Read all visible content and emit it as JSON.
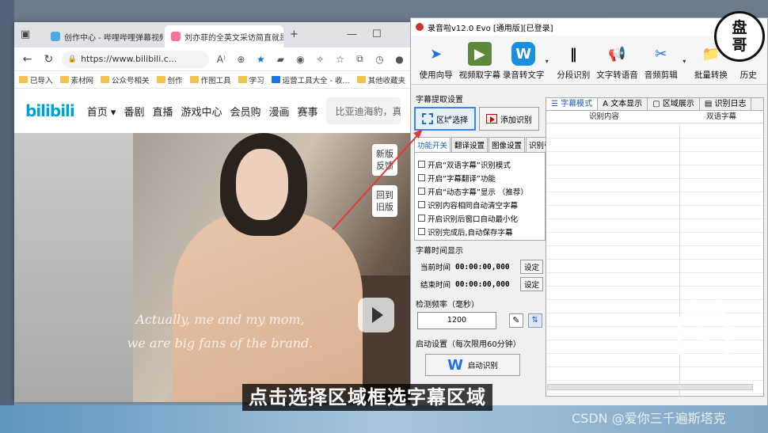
{
  "browser": {
    "tabs": [
      {
        "title": "创作中心 - 哔哩哔哩弹幕视频网",
        "close": "✕"
      },
      {
        "title": "刘亦菲的全英文采访简直就是一",
        "close": "✕"
      }
    ],
    "new_tab": "+",
    "minimize": "—",
    "maximize": "☐",
    "url": "https://www.bilibili.c...",
    "toolbar_icons": {
      "read_aloud": "A⁾",
      "zoom": "⊕",
      "favorite": "★"
    },
    "bookmarks": [
      "已导入",
      "素材网",
      "公众号相关",
      "创作",
      "作图工具",
      "学习",
      "运营工具大全 - 收...",
      "其他收藏夹"
    ]
  },
  "bili": {
    "logo": "bilibili",
    "nav": [
      "首页",
      "番剧",
      "直播",
      "游戏中心",
      "会员购",
      "漫画",
      "赛事"
    ],
    "search_placeholder": "比亚迪海豹，真有网上吹",
    "float_new": "新版 反馈",
    "float_old": "回到 旧版",
    "subtitle_en_1": "Actually, me and my mom,",
    "subtitle_en_2": "we are big fans of the brand."
  },
  "app": {
    "title": "录音啦v12.0 Evo [通用版][已登录]",
    "tools": [
      {
        "label": "使用向导",
        "icon": "➤"
      },
      {
        "label": "视频取字幕",
        "icon": "▶"
      },
      {
        "label": "录音转文字",
        "icon": "W"
      },
      {
        "label": "分段识别",
        "icon": "‖"
      },
      {
        "label": "文字转语音",
        "icon": "📢"
      },
      {
        "label": "音频剪辑",
        "icon": "✂"
      },
      {
        "label": "批量转换",
        "icon": "📁"
      },
      {
        "label": "历史",
        "icon": "⟲"
      }
    ],
    "group_subtitle": "字幕提取设置",
    "btn_region": "区域选择",
    "btn_add": "添加识别",
    "subtabs": [
      "功能开关",
      "翻译设置",
      "图像设置",
      "识别引擎"
    ],
    "options": [
      "开启“双语字幕”识别模式",
      "开启“字幕翻译”功能",
      "开启“动态字幕”显示 （推荐）",
      "识别内容相同自动清空字幕",
      "开启识别后窗口自动最小化",
      "识别完成后,自动保存字幕"
    ],
    "group_time": "字幕时间显示",
    "current_time_label": "当前时间",
    "current_time": "00:00:00,000",
    "end_time_label": "结束时间",
    "end_time": "00:00:00,000",
    "set_label": "设定",
    "group_freq": "检测频率（毫秒）",
    "freq": "1200",
    "group_start": "启动设置（每次限用60分钟）",
    "btn_start": "启动识别",
    "right_tabs": [
      "字幕模式",
      "文本显示",
      "区域展示",
      "识别日志"
    ],
    "col1": "识别内容",
    "col2": "双语字幕"
  },
  "overlay": {
    "caption": "点击选择区域框选字幕区域",
    "seal_top": "盘",
    "seal_bottom": "哥",
    "watermark": "CSDN @爱你三千遍斯塔克"
  }
}
